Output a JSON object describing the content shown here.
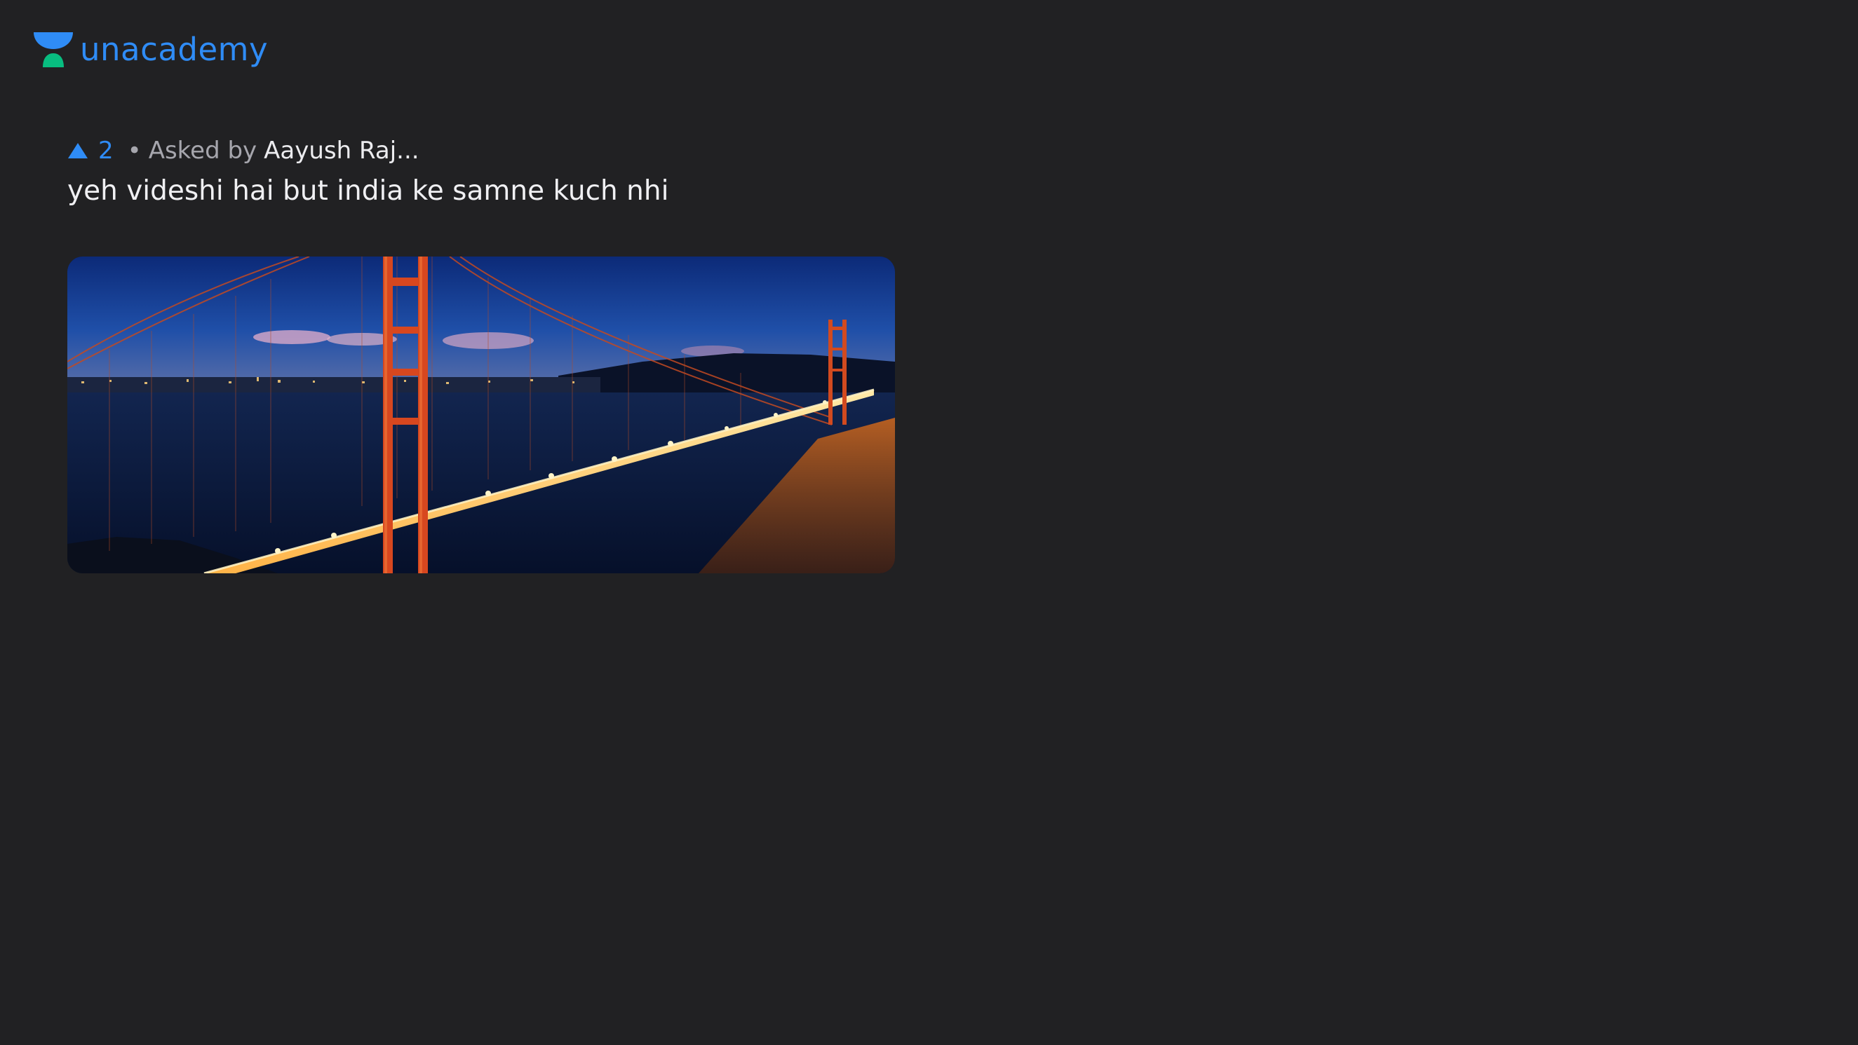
{
  "brand": {
    "name": "unacademy",
    "colors": {
      "primary": "#2f8cf6",
      "secondary": "#08bd80"
    }
  },
  "question": {
    "upvote_icon": "upvote-triangle-icon",
    "upvotes": "2",
    "separator": "•",
    "asked_by_label": "Asked by",
    "asker_name": "Aayush Raj...",
    "text": "yeh videshi hai but india ke samne kuch nhi",
    "image": {
      "subject": "suspension-bridge-at-night-photo"
    }
  },
  "colors": {
    "background": "#212123",
    "meta_text": "#a6a6ad",
    "question_text": "#f0f0f3"
  }
}
